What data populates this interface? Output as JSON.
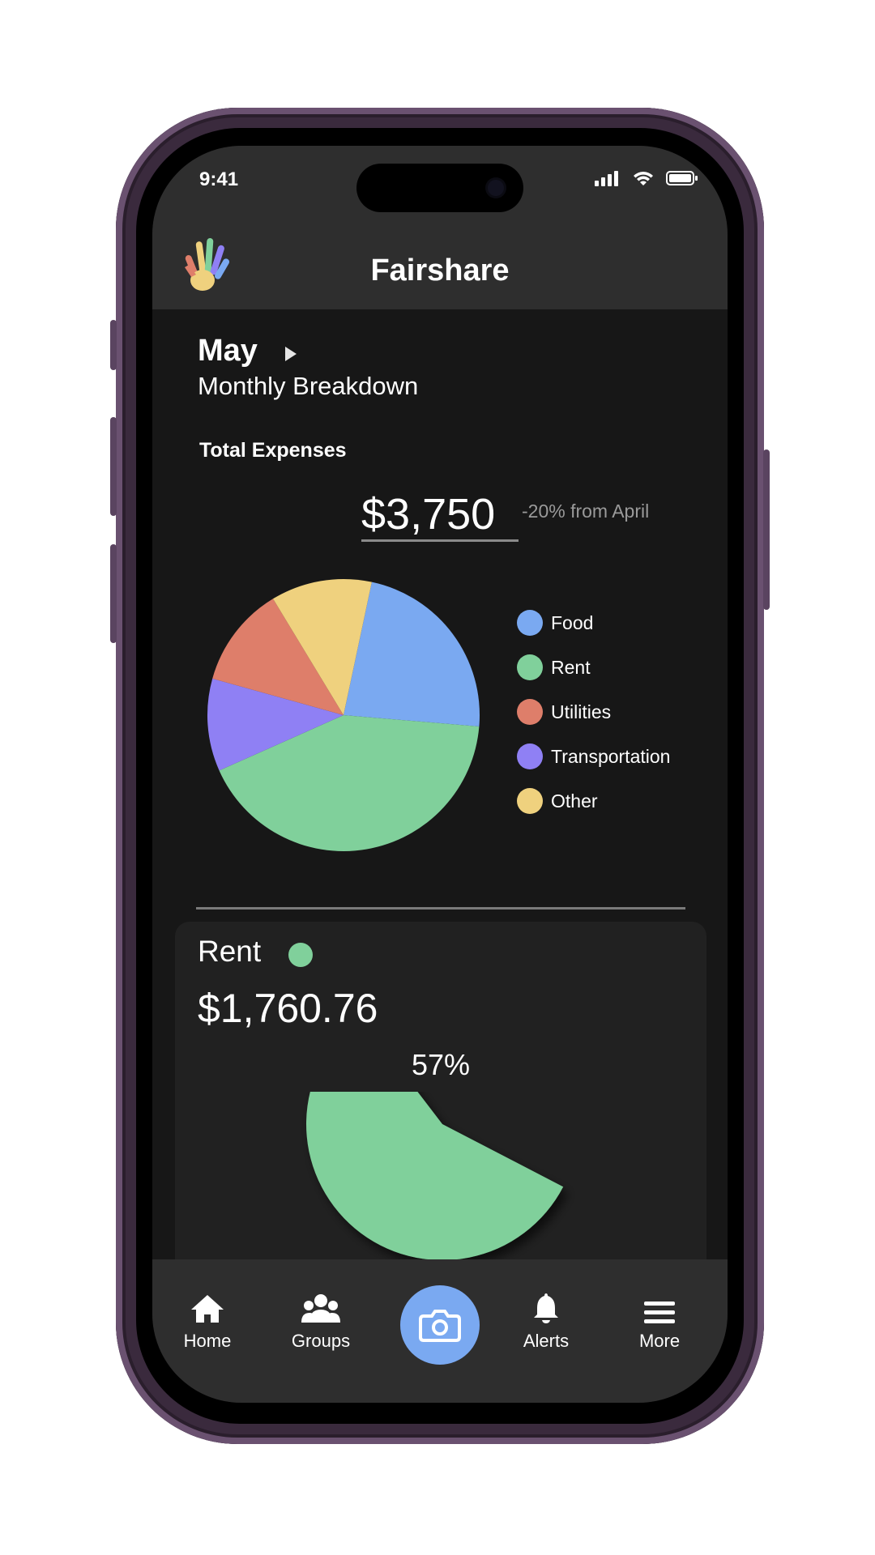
{
  "status_bar": {
    "time": "9:41"
  },
  "header": {
    "title": "Fairshare",
    "logo_icon": "hand-logo-icon"
  },
  "period": {
    "month": "May",
    "subtitle": "Monthly Breakdown"
  },
  "summary": {
    "label": "Total Expenses",
    "total": "$3,750",
    "change": "-20% from April"
  },
  "colors": {
    "food": "#7aa9f1",
    "rent": "#80d09b",
    "utilities": "#de7e6a",
    "transportation": "#8f80f4",
    "other": "#efd17e",
    "accent": "#7aa9f1"
  },
  "chart_data": {
    "type": "pie",
    "title": "",
    "slices": [
      {
        "label": "Food",
        "value": 23,
        "color": "#7aa9f1"
      },
      {
        "label": "Rent",
        "value": 42,
        "color": "#80d09b"
      },
      {
        "label": "Transportation",
        "value": 11,
        "color": "#8f80f4"
      },
      {
        "label": "Utilities",
        "value": 12,
        "color": "#de7e6a"
      },
      {
        "label": "Other",
        "value": 12,
        "color": "#efd17e"
      }
    ],
    "legend": [
      "Food",
      "Rent",
      "Utilities",
      "Transportation",
      "Other"
    ],
    "legend_placement": "right"
  },
  "detail": {
    "category": "Rent",
    "amount": "$1,760.76",
    "percent_label": "57%",
    "percent": 57,
    "color": "#80d09b"
  },
  "tabs": [
    {
      "label": "Home",
      "icon": "home-icon"
    },
    {
      "label": "Groups",
      "icon": "groups-icon"
    },
    {
      "label": "",
      "icon": "camera-icon"
    },
    {
      "label": "Alerts",
      "icon": "bell-icon"
    },
    {
      "label": "More",
      "icon": "menu-icon"
    }
  ]
}
